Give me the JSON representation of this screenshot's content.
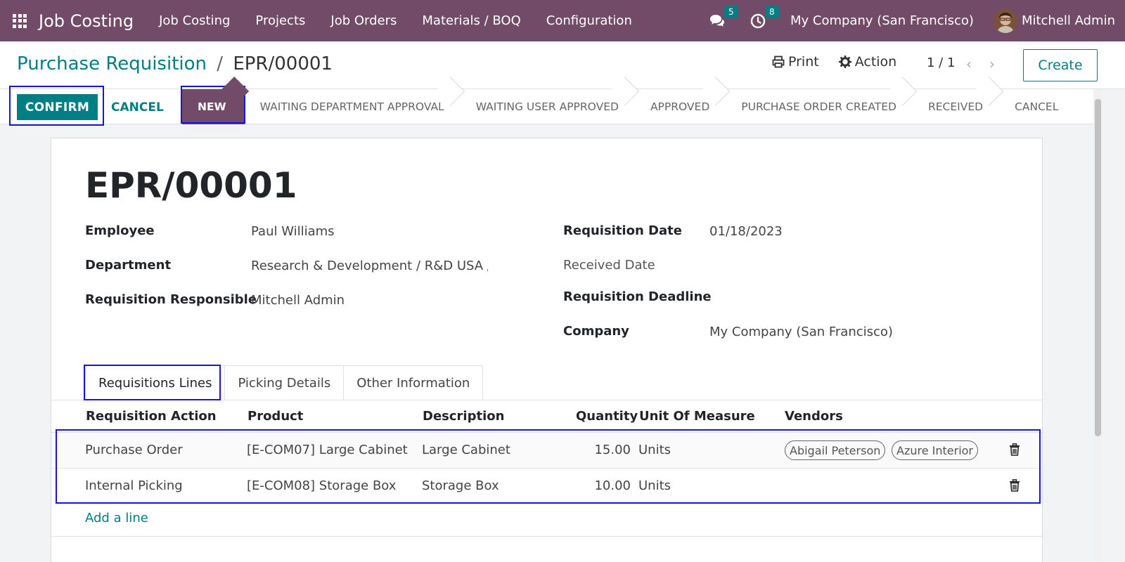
{
  "navbar": {
    "app_name": "Job Costing",
    "menu": [
      "Job Costing",
      "Projects",
      "Job Orders",
      "Materials / BOQ",
      "Configuration"
    ],
    "messages_count": "5",
    "activities_count": "8",
    "company": "My Company (San Francisco)",
    "user": "Mitchell Admin"
  },
  "breadcrumb": {
    "parent": "Purchase Requisition",
    "separator": "/",
    "current": "EPR/00001"
  },
  "control": {
    "print_label": "Print",
    "action_label": "Action",
    "pager": "1 / 1",
    "create_label": "Create"
  },
  "statusbar": {
    "confirm_label": "CONFIRM",
    "cancel_label": "CANCEL",
    "stages": [
      "NEW",
      "WAITING DEPARTMENT APPROVAL",
      "WAITING USER APPROVED",
      "APPROVED",
      "PURCHASE ORDER CREATED",
      "RECEIVED",
      "CANCEL"
    ],
    "active_stage": "NEW"
  },
  "form": {
    "name": "EPR/00001",
    "employee_label": "Employee",
    "employee": "Paul Williams",
    "department_label": "Department",
    "department": "Research & Development / R&D USA / L",
    "responsible_label": "Requisition Responsible",
    "responsible": "Mitchell Admin",
    "req_date_label": "Requisition Date",
    "req_date": "01/18/2023",
    "received_date_label": "Received Date",
    "deadline_label": "Requisition Deadline",
    "company_label": "Company",
    "company": "My Company (San Francisco)"
  },
  "tabs": [
    "Requisitions Lines",
    "Picking Details",
    "Other Information"
  ],
  "lines": {
    "headers": [
      "Requisition Action",
      "Product",
      "Description",
      "Quantity",
      "Unit Of Measure",
      "Vendors"
    ],
    "rows": [
      {
        "action": "Purchase Order",
        "product": "[E-COM07] Large Cabinet",
        "description": "Large Cabinet",
        "quantity": "15.00",
        "uom": "Units",
        "vendors": [
          "Abigail Peterson",
          "Azure Interior"
        ]
      },
      {
        "action": "Internal Picking",
        "product": "[E-COM08] Storage Box",
        "description": "Storage Box",
        "quantity": "10.00",
        "uom": "Units",
        "vendors": []
      }
    ],
    "add_line": "Add a line"
  },
  "colors": {
    "brand": "#714b67",
    "accent": "#017e84",
    "highlight": "#1418d6"
  }
}
